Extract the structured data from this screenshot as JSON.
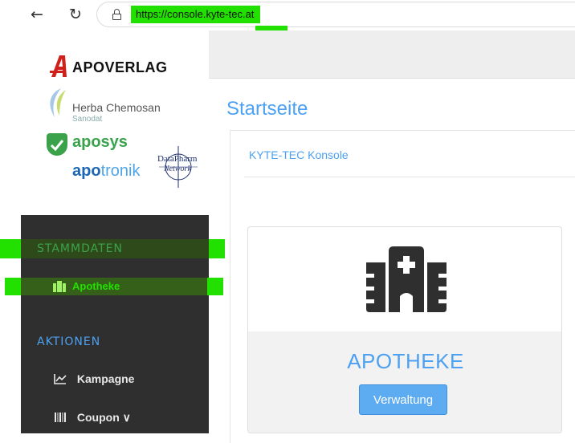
{
  "browser": {
    "url": "https://console.kyte-tec.at",
    "back_glyph": "←",
    "reload_glyph": "↻"
  },
  "logos": {
    "apoverlag": "APOVERLAG",
    "herba_name": "Herba Chemosan",
    "herba_sub": "Sanodat",
    "aposys": "aposys",
    "apotronik_a": "apo",
    "apotronik_b": "tronik",
    "datapharm_1": "DataPharm",
    "datapharm_2": "Network"
  },
  "sidebar": {
    "section_stammdaten": "STAMMDATEN",
    "item_apotheke": "Apotheke",
    "section_aktionen": "AKTIONEN",
    "item_kampagne": "Kampagne",
    "item_coupon": "Coupon",
    "coupon_chevron": "∨"
  },
  "main": {
    "page_title": "Startseite",
    "breadcrumb": "KYTE-TEC Konsole",
    "card_title": "APOTHEKE",
    "card_button": "Verwaltung"
  },
  "colors": {
    "accent": "#4da1f0",
    "sidebar_bg": "#2f2f2f",
    "highlight": "#22e000",
    "button": "#5dabf0"
  },
  "icons": {
    "apotheke": "hospital-icon",
    "kampagne": "line-chart-icon",
    "coupon": "barcode-icon"
  }
}
